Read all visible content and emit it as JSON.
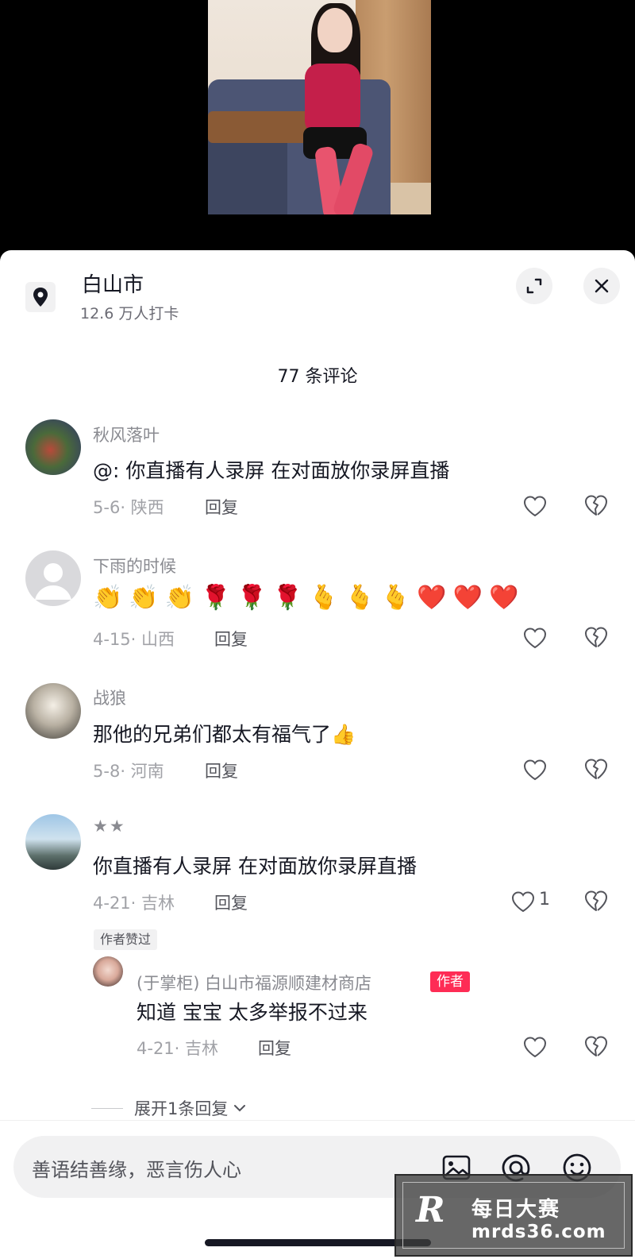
{
  "location": {
    "title": "白山市",
    "subtitle": "12.6 万人打卡"
  },
  "comments_header": "77 条评论",
  "comments": [
    {
      "name": "秋风落叶",
      "text": "@: 你直播有人录屏  在对面放你录屏直播",
      "date": "5-6",
      "region": "陕西",
      "reply_label": "回复"
    },
    {
      "name": "下雨的时候",
      "emoji": [
        "👏",
        "👏",
        "👏",
        "🌹",
        "🌹",
        "🌹",
        "🫰",
        "🫰",
        "🫰",
        "❤️",
        "❤️",
        "❤️"
      ],
      "date": "4-15",
      "region": "山西",
      "reply_label": "回复"
    },
    {
      "name": "战狼",
      "text": "那他的兄弟们都太有福气了👍",
      "date": "5-8",
      "region": "河南",
      "reply_label": "回复"
    },
    {
      "name": "★★",
      "text": "你直播有人录屏  在对面放你录屏直播",
      "date": "4-21",
      "region": "吉林",
      "reply_label": "回复",
      "likes": "1",
      "badge": "作者赞过",
      "sub_reply": {
        "name": "(于掌柜) 白山市福源顺建材商店",
        "author_tag": "作者",
        "text": "知道 宝宝 太多举报不过来",
        "date": "4-21",
        "region": "吉林",
        "reply_label": "回复"
      }
    }
  ],
  "expand_replies": "展开1条回复",
  "input": {
    "placeholder": "善语结善缘，恶言伤人心"
  },
  "watermark": {
    "logo": "R",
    "name": "每日大赛",
    "url": "mrds36.com"
  },
  "colors": {
    "accent": "#fe2c55",
    "text_primary": "#161823",
    "text_secondary": "#8a8b91"
  }
}
